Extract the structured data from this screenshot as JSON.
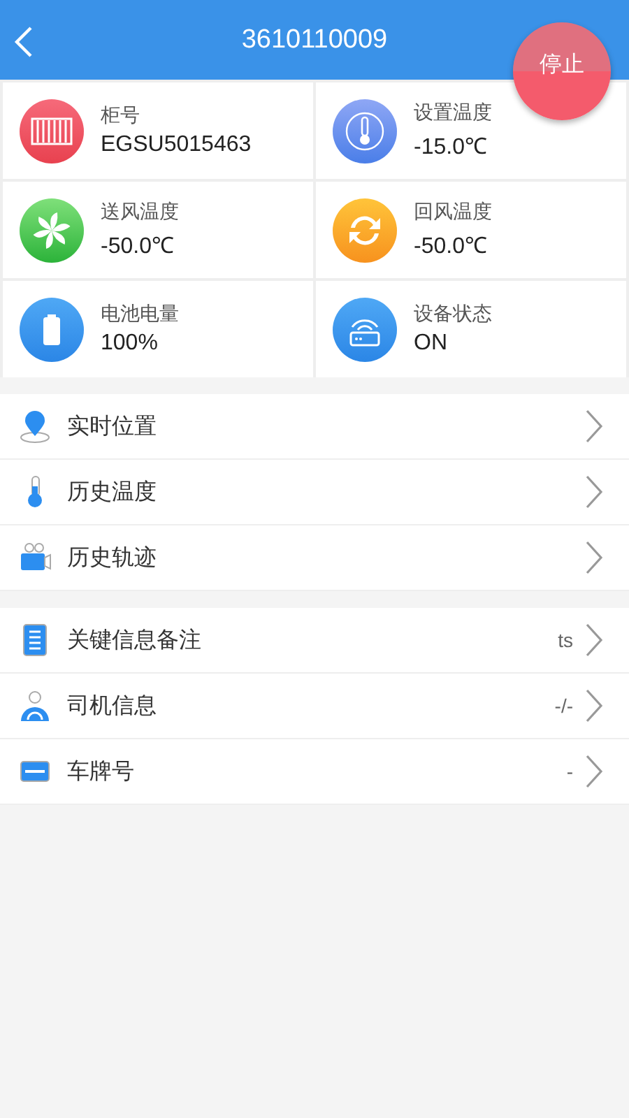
{
  "header": {
    "title": "3610110009"
  },
  "stop_button": {
    "label": "停止"
  },
  "cards": [
    {
      "label": "柜号",
      "value": "EGSU5015463"
    },
    {
      "label": "设置温度",
      "value": "-15.0℃"
    },
    {
      "label": "送风温度",
      "value": "-50.0℃"
    },
    {
      "label": "回风温度",
      "value": "-50.0℃"
    },
    {
      "label": "电池电量",
      "value": "100%"
    },
    {
      "label": "设备状态",
      "value": "ON"
    }
  ],
  "menu_groups": [
    [
      {
        "label": "实时位置"
      },
      {
        "label": "历史温度"
      },
      {
        "label": "历史轨迹"
      }
    ],
    [
      {
        "label": "关键信息备注",
        "value": "ts"
      },
      {
        "label": "司机信息",
        "value": "-/-"
      },
      {
        "label": "车牌号",
        "value": "-"
      }
    ]
  ]
}
